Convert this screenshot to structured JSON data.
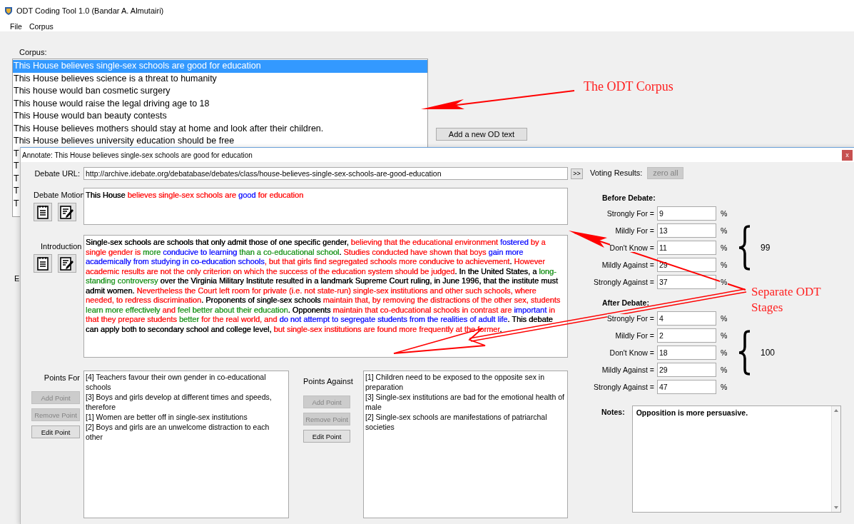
{
  "window": {
    "title": "ODT Coding Tool 1.0 (Bandar A. Almutairi)"
  },
  "menu": [
    "File",
    "Corpus"
  ],
  "corpus": {
    "label": "Corpus:",
    "items": [
      {
        "text": "This House believes single-sex schools are good for education",
        "selected": true
      },
      {
        "text": "This House believes science is a threat to humanity",
        "selected": false
      },
      {
        "text": "This house would ban cosmetic surgery",
        "selected": false
      },
      {
        "text": "This house would raise the legal driving age to 18",
        "selected": false
      },
      {
        "text": "This House would ban beauty contests",
        "selected": false
      },
      {
        "text": "This House believes mothers should stay at home and look after their children.",
        "selected": false
      },
      {
        "text": "This House believes university education should be free",
        "selected": false
      },
      {
        "text": "T",
        "selected": false
      },
      {
        "text": "T",
        "selected": false
      },
      {
        "text": "T",
        "selected": false
      },
      {
        "text": "T",
        "selected": false
      },
      {
        "text": "T",
        "selected": false
      }
    ],
    "add_button": "Add a new OD text"
  },
  "covered_label": "E",
  "annotate_dialog": {
    "title": "Annotate: This House believes single-sex schools are good for education",
    "close_button": "x",
    "debate_url": {
      "label": "Debate URL:",
      "value": "http://archive.idebate.org/debatabase/debates/class/house-believes-single-sex-schools-are-good-education"
    },
    "go_button": ">>",
    "motion": {
      "label": "Debate Motion",
      "segments": [
        {
          "text": "This House "
        },
        {
          "text": "believes single-sex schools are ",
          "color": "#ff2020"
        },
        {
          "text": "good",
          "color": "#2020ff"
        },
        {
          "text": " for education",
          "color": "#ff2020"
        }
      ]
    },
    "introduction": {
      "label": "Introduction",
      "segments": [
        {
          "text": "Single-sex schools are schools that only admit those of one specific gender, "
        },
        {
          "text": "believing that the educational environment ",
          "color": "#ff2020"
        },
        {
          "text": "fostered",
          "color": "#2020ff"
        },
        {
          "text": " by a single gender is ",
          "color": "#ff2020"
        },
        {
          "text": "more",
          "color": "#2a9a2a"
        },
        {
          "text": " conducive to learning",
          "color": "#2020ff"
        },
        {
          "text": " than a co-educational school",
          "color": "#2a9a2a"
        },
        {
          "text": ". "
        },
        {
          "text": "Studies conducted have shown that boys ",
          "color": "#ff2020"
        },
        {
          "text": "gain more academically from studying in co-education schools",
          "color": "#2020ff"
        },
        {
          "text": ", but that girls find segregated schools more conducive to achievement",
          "color": "#ff2020"
        },
        {
          "text": ". "
        },
        {
          "text": "However academic results are not the only criterion on which the success of the education system should be judged",
          "color": "#ff2020"
        },
        {
          "text": ". In the United States, a "
        },
        {
          "text": "long-standing controversy",
          "color": "#2a9a2a"
        },
        {
          "text": " over the Virginia Military Institute resulted in a landmark Supreme Court ruling, in June 1996, that the institute must admit women. "
        },
        {
          "text": "Nevertheless the Court left room for private (i.e. not state-run) single-sex institutions and other such schools, where needed, to redress discrimination",
          "color": "#ff2020"
        },
        {
          "text": ". Proponents of single-sex schools "
        },
        {
          "text": "maintain that, by removing the distractions of the other sex, students ",
          "color": "#ff2020"
        },
        {
          "text": "learn more effectively",
          "color": "#2a9a2a"
        },
        {
          "text": " and ",
          "color": "#ff2020"
        },
        {
          "text": "feel better about their education",
          "color": "#2a9a2a"
        },
        {
          "text": ". Opponents "
        },
        {
          "text": "maintain that co-educational schools in contrast are ",
          "color": "#ff2020"
        },
        {
          "text": "important",
          "color": "#2020ff"
        },
        {
          "text": " in that they prepare students ",
          "color": "#ff2020"
        },
        {
          "text": "better",
          "color": "#2a9a2a"
        },
        {
          "text": " for the real world, and ",
          "color": "#ff2020"
        },
        {
          "text": "do not attempt to segregate students from the realities of adult life",
          "color": "#2020ff"
        },
        {
          "text": ". This debate can apply both to secondary school and college level, "
        },
        {
          "text": "but single-sex institutions are found more frequently at the former",
          "color": "#ff2020"
        },
        {
          "text": "."
        }
      ]
    },
    "points_for": {
      "label": "Points For",
      "items": [
        "[4] Teachers favour their own gender in co-educational schools",
        "[3] Boys and girls develop at different times and speeds, therefore",
        "[1] Women are better off in single-sex institutions",
        "[2] Boys and girls are an unwelcome distraction to each other"
      ],
      "buttons": [
        {
          "label": "Add Point",
          "disabled": true
        },
        {
          "label": "Remove Point",
          "disabled": true
        },
        {
          "label": "Edit Point",
          "disabled": false
        }
      ]
    },
    "points_against": {
      "label": "Points Against",
      "items": [
        "[1] Children need to be exposed to the opposite sex in preparation",
        "[3] Single-sex institutions are bad for the emotional health of male",
        "[2] Single-sex schools are manifestations of patriarchal societies"
      ],
      "buttons": [
        {
          "label": "Add Point",
          "disabled": true
        },
        {
          "label": "Remove Point",
          "disabled": true
        },
        {
          "label": "Edit Point",
          "disabled": false
        }
      ]
    },
    "voting": {
      "label": "Voting Results:",
      "zero_button": {
        "label": "zero all",
        "disabled": true
      },
      "stages": [
        {
          "title": "Before Debate:",
          "rows": [
            {
              "label": "Strongly For =",
              "value": "9"
            },
            {
              "label": "Mildly For =",
              "value": "13"
            },
            {
              "label": "Don't Know =",
              "value": "11"
            },
            {
              "label": "Mildly Against =",
              "value": "29"
            },
            {
              "label": "Strongly Against =",
              "value": "37"
            }
          ],
          "unit": "%",
          "total": "99"
        },
        {
          "title": "After Debate:",
          "rows": [
            {
              "label": "Strongly For =",
              "value": "4"
            },
            {
              "label": "Mildly For =",
              "value": "2"
            },
            {
              "label": "Don't Know =",
              "value": "18"
            },
            {
              "label": "Mildly Against =",
              "value": "29"
            },
            {
              "label": "Strongly Against =",
              "value": "47"
            }
          ],
          "unit": "%",
          "total": "100"
        }
      ]
    },
    "notes": {
      "label": "Notes:",
      "value": "Opposition is more persuasive."
    }
  },
  "annotations": [
    "The ODT Corpus",
    "Separate ODT Stages"
  ]
}
